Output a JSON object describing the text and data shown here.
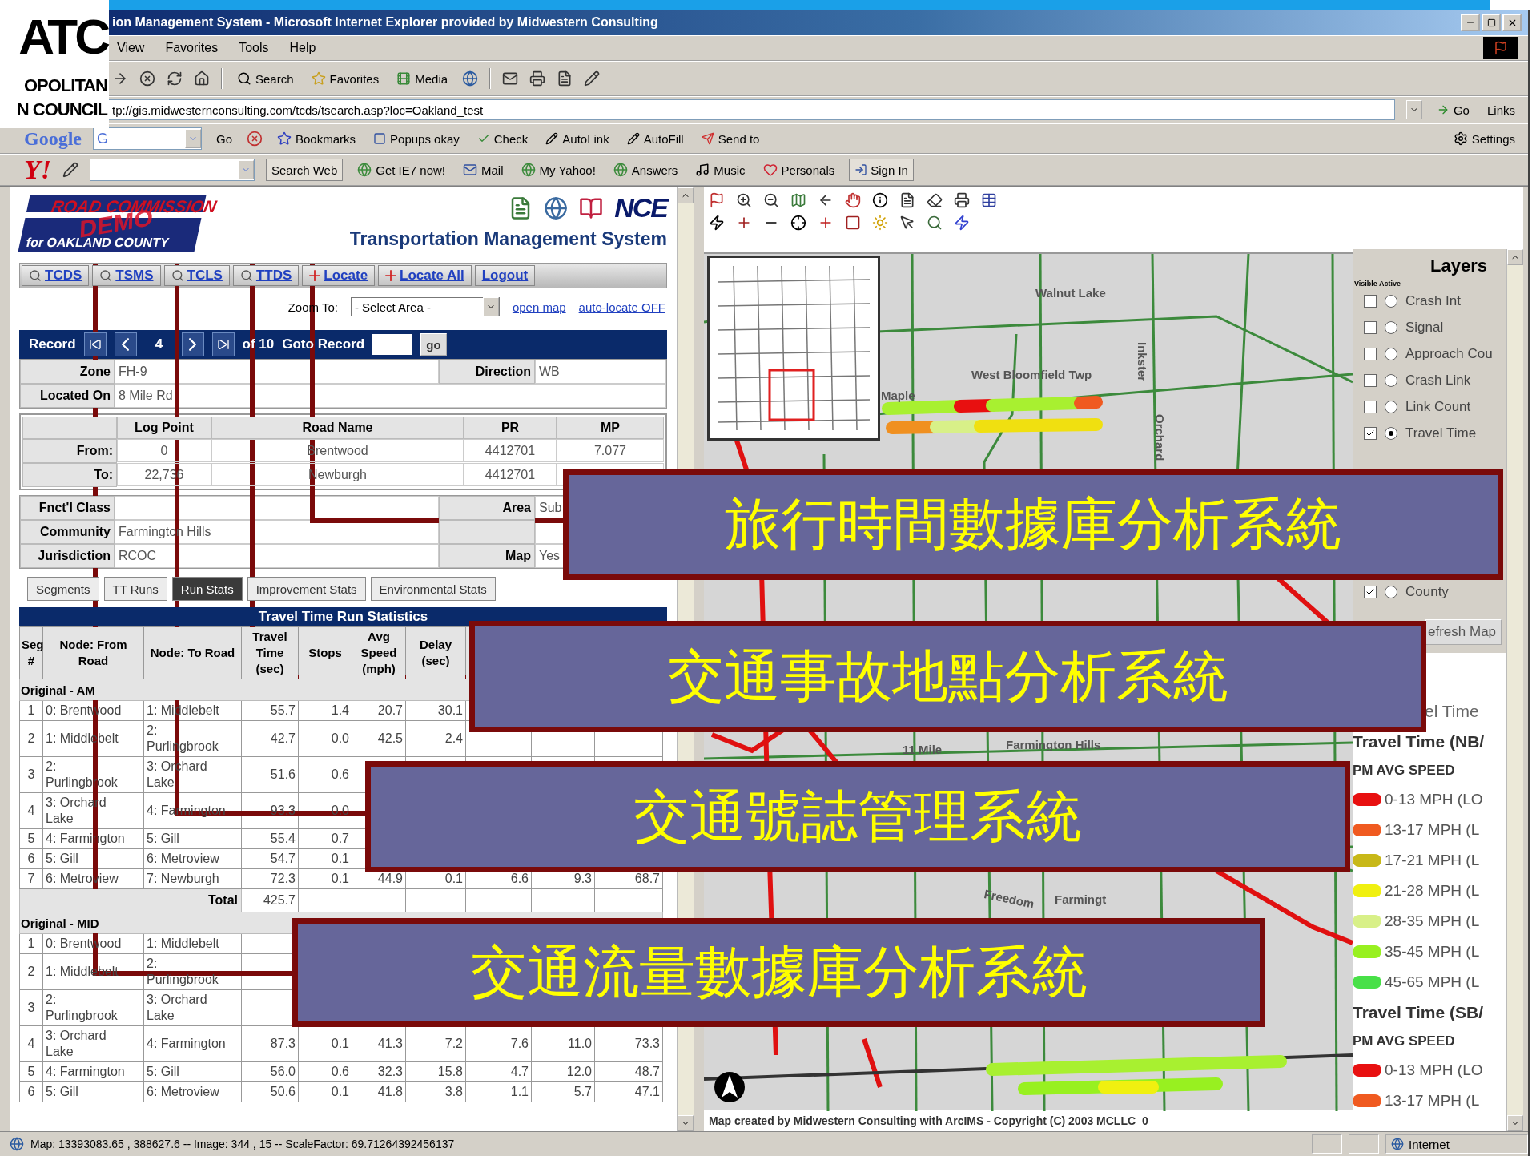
{
  "slide": {
    "logo_lines": [
      "ATC",
      "OPOLITAN",
      "N COUNCIL"
    ]
  },
  "window": {
    "title": "ion Management System - Microsoft Internet Explorer provided by Midwestern Consulting"
  },
  "menu": [
    "View",
    "Favorites",
    "Tools",
    "Help"
  ],
  "toolbar": [
    "Search",
    "Favorites",
    "Media"
  ],
  "address": {
    "value": "tp://gis.midwesternconsulting.com/tcds/tsearch.asp?loc=Oakland_test",
    "go": "Go",
    "links": "Links"
  },
  "google_bar": {
    "logo": "Google",
    "field": "G",
    "go": "Go",
    "items": [
      "Bookmarks",
      "Popups okay",
      "Check",
      "AutoLink",
      "AutoFill",
      "Send to"
    ],
    "settings": "Settings"
  },
  "yahoo_bar": {
    "logo": "Y!",
    "search": "Search Web",
    "items": [
      "Get IE7 now!",
      "Mail",
      "My Yahoo!",
      "Answers",
      "Music",
      "Personals"
    ],
    "sign_in": "Sign In"
  },
  "app": {
    "logo": {
      "name": "ROAD COMMISSION",
      "sub": "for OAKLAND COUNTY",
      "stamp": "DEMO"
    },
    "brand": "NCE",
    "title": "Transportation Management System",
    "nav": [
      {
        "label": "TCDS",
        "kind": "search"
      },
      {
        "label": "TSMS",
        "kind": "search"
      },
      {
        "label": "TCLS",
        "kind": "search"
      },
      {
        "label": "TTDS",
        "kind": "search"
      },
      {
        "label": "Locate",
        "kind": "locate"
      },
      {
        "label": "Locate All",
        "kind": "locate"
      },
      {
        "label": "Logout",
        "kind": "plain"
      }
    ],
    "zoom": {
      "label": "Zoom To:",
      "select": "- Select Area -",
      "links": [
        "open map",
        "auto-locate OFF"
      ]
    },
    "record": {
      "label": "Record",
      "current": "4",
      "total": "of 10",
      "goto": "Goto Record",
      "go": "go"
    },
    "info_top": [
      {
        "label": "Zone",
        "value": "FH-9",
        "label2": "Direction",
        "value2": "WB"
      },
      {
        "label": "Located On",
        "value": "8 Mile Rd"
      }
    ],
    "log": {
      "columns": [
        "Log Point",
        "Road Name",
        "PR",
        "MP"
      ],
      "rows": [
        {
          "label": "From:",
          "cells": [
            "0",
            "Brentwood",
            "4412701",
            "7.077"
          ]
        },
        {
          "label": "To:",
          "cells": [
            "22,736",
            "Newburgh",
            "4412701",
            null
          ]
        }
      ]
    },
    "info_bottom": [
      {
        "label": "Fnct'l Class",
        "label2": "Area",
        "value2": "Sub"
      },
      {
        "label": "Community",
        "value": "Farmington Hills"
      },
      {
        "label": "Jurisdiction",
        "value": "RCOC",
        "label2": "Map",
        "value2": "Yes"
      }
    ],
    "sub_tabs": [
      {
        "label": "Segments",
        "selected": false
      },
      {
        "label": "TT Runs",
        "selected": false
      },
      {
        "label": "Run Stats",
        "selected": true
      },
      {
        "label": "Improvement Stats",
        "selected": false
      },
      {
        "label": "Environmental Stats",
        "selected": false
      }
    ],
    "stats": {
      "title": "Travel Time Run Statistics",
      "columns": [
        "Seg #",
        "Node: From Road",
        "Node: To Road",
        "Travel Time (sec)",
        "Stops",
        "Avg Speed (mph)",
        "Delay (sec)"
      ],
      "groups": [
        {
          "label": "Original - AM",
          "rows": [
            [
              "1",
              "0: Brentwood",
              "1: Middlebelt",
              "55.7",
              "1.4",
              "20.7",
              "30.1",
              null,
              null,
              null
            ],
            [
              "2",
              "1: Middlebelt",
              "2: Purlingbrook",
              "42.7",
              "0.0",
              "42.5",
              "2.4",
              null,
              null,
              null
            ],
            [
              "3",
              "2: Purlingbrook",
              "3: Orchard Lake",
              "51.6",
              "0.6",
              null,
              null,
              null,
              null,
              null
            ],
            [
              "4",
              "3: Orchard Lake",
              "4: Farmington",
              "93.3",
              "0.0",
              null,
              null,
              null,
              null,
              null
            ],
            [
              "5",
              "4: Farmington",
              "5: Gill",
              "55.4",
              "0.7",
              null,
              null,
              null,
              null,
              null
            ],
            [
              "6",
              "5: Gill",
              "6: Metroview",
              "54.7",
              "0.1",
              null,
              null,
              null,
              null,
              null
            ],
            [
              "7",
              "6: Metroview",
              "7: Newburgh",
              "72.3",
              "0.1",
              "44.9",
              "0.1",
              "6.6",
              "9.3",
              "68.7"
            ]
          ],
          "total": {
            "label": "Total",
            "cells": [
              "425.7"
            ]
          }
        },
        {
          "label": "Original - MID",
          "rows": [
            [
              "1",
              "0: Brentwood",
              "1: Middlebelt",
              null,
              null,
              null,
              null,
              null,
              null,
              null
            ],
            [
              "2",
              "1: Middlebelt",
              "2: Purlingbrook",
              null,
              null,
              null,
              null,
              null,
              null,
              null
            ],
            [
              "3",
              "2: Purlingbrook",
              "3: Orchard Lake",
              null,
              null,
              null,
              null,
              null,
              null,
              null
            ],
            [
              "4",
              "3: Orchard Lake",
              "4: Farmington",
              "87.3",
              "0.1",
              "41.3",
              "7.2",
              "7.6",
              "11.0",
              "73.3"
            ],
            [
              "5",
              "4: Farmington",
              "5: Gill",
              "56.0",
              "0.6",
              "32.3",
              "15.8",
              "4.7",
              "12.0",
              "48.7"
            ],
            [
              "6",
              "5: Gill",
              "6: Metroview",
              "50.6",
              "0.1",
              "41.8",
              "3.8",
              "1.1",
              "5.7",
              "47.1"
            ]
          ]
        }
      ]
    }
  },
  "map": {
    "labels": [
      "Walnut Lake",
      "West Bloomfield Twp",
      "Maple",
      "Orchard",
      "Inkster",
      "11 Mile",
      "Farmington Hills",
      "Freedom",
      "Farmingt"
    ],
    "credit": "Map created by Midwestern Consulting with ArcIMS - Copyright (C) 2003 MCLLC",
    "scale_label": "0"
  },
  "layers": {
    "title": "Layers",
    "header": "Visible Active",
    "items": [
      {
        "label": "Crash Int",
        "visible": false,
        "active": false
      },
      {
        "label": "Signal",
        "visible": false,
        "active": false
      },
      {
        "label": "Approach Cou",
        "visible": false,
        "active": false
      },
      {
        "label": "Crash Link",
        "visible": false,
        "active": false
      },
      {
        "label": "Link Count",
        "visible": false,
        "active": false
      },
      {
        "label": "Travel Time",
        "visible": true,
        "active": true
      }
    ],
    "items_lower": [
      {
        "label": "County",
        "visible": true,
        "active": false
      }
    ],
    "refresh": "efresh Map",
    "legend": [
      {
        "kind": "heading",
        "text": "el Time"
      },
      {
        "kind": "title",
        "text": "Travel Time (NB/"
      },
      {
        "kind": "subtitle",
        "text": "PM AVG SPEED"
      },
      {
        "kind": "item",
        "text": "0-13 MPH (LO",
        "color": "#e81010"
      },
      {
        "kind": "item",
        "text": "13-17 MPH (L",
        "color": "#f05a20"
      },
      {
        "kind": "item",
        "text": "17-21 MPH (L",
        "color": "#c8b818"
      },
      {
        "kind": "item",
        "text": "21-28 MPH (L",
        "color": "#f0f010"
      },
      {
        "kind": "item",
        "text": "28-35 MPH (L",
        "color": "#d8f088"
      },
      {
        "kind": "item",
        "text": "35-45 MPH (L",
        "color": "#98f020"
      },
      {
        "kind": "item",
        "text": "45-65 MPH (L",
        "color": "#48e048"
      },
      {
        "kind": "title",
        "text": "Travel Time (SB/"
      },
      {
        "kind": "subtitle",
        "text": "PM AVG SPEED"
      },
      {
        "kind": "item",
        "text": "0-13 MPH (LO",
        "color": "#e81010"
      },
      {
        "kind": "item",
        "text": "13-17 MPH (L",
        "color": "#f05a20"
      }
    ]
  },
  "status": {
    "text": "Map: 13393083.65 , 388627.6 -- Image: 344 , 15 -- ScaleFactor: 69.71264392456137",
    "zone": "Internet"
  },
  "callouts": [
    "旅行時間數據庫分析系統",
    "交通事故地點分析系統",
    "交通號誌管理系統",
    "交通流量數據庫分析系統"
  ]
}
